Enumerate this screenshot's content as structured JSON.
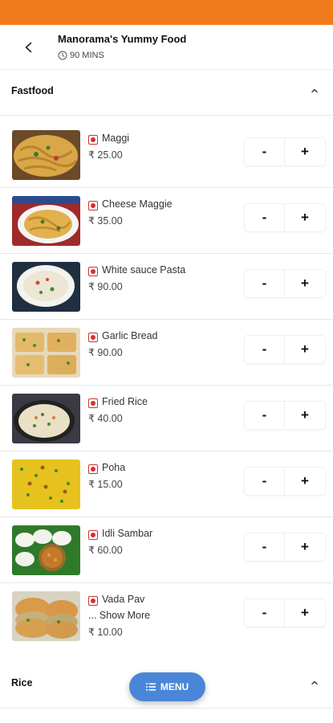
{
  "header": {
    "shop_name": "Manorama's Yummy Food",
    "eta": "90 MINS"
  },
  "sections": {
    "fastfood": "Fastfood",
    "rice": "Rice"
  },
  "items": [
    {
      "name": "Maggi",
      "price": "₹ 25.00"
    },
    {
      "name": "Cheese Maggie",
      "price": "₹ 35.00"
    },
    {
      "name": "White sauce Pasta",
      "price": "₹ 90.00"
    },
    {
      "name": "Garlic Bread",
      "price": "₹ 90.00"
    },
    {
      "name": "Fried Rice",
      "price": "₹ 40.00"
    },
    {
      "name": "Poha",
      "price": "₹ 15.00"
    },
    {
      "name": "Idli Sambar",
      "price": "₹ 60.00"
    },
    {
      "name": "Vada Pav",
      "show_more": "... Show More",
      "price": "₹ 10.00"
    }
  ],
  "stepper": {
    "minus": "-",
    "plus": "+"
  },
  "fab": {
    "label": "MENU"
  },
  "colors": {
    "status_bar": "#f07b1c",
    "fab": "#4a86d8",
    "non_veg_mark": "#d32f2f"
  },
  "icons": [
    "back-arrow-icon",
    "clock-icon",
    "chevron-up-icon",
    "non-veg-icon",
    "list-icon"
  ]
}
